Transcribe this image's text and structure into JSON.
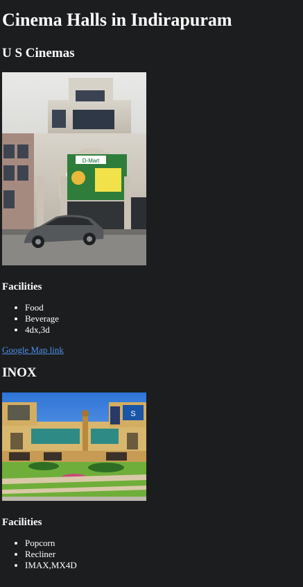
{
  "page": {
    "title": "Cinema Halls in Indirapuram"
  },
  "cinemas": [
    {
      "name": "U S Cinemas",
      "photo_sign": "D-Mart",
      "facilities_heading": "Facilities",
      "facilities": [
        "Food",
        "Beverage",
        "4dx,3d"
      ],
      "map_link": "Google Map link"
    },
    {
      "name": "INOX",
      "photo_sign": "S",
      "facilities_heading": "Facilities",
      "facilities": [
        "Popcorn",
        "Recliner",
        "IMAX,MX4D"
      ]
    }
  ],
  "colors": {
    "background": "#1c1d1f",
    "text": "#ffffff",
    "link": "#4f8fea"
  }
}
